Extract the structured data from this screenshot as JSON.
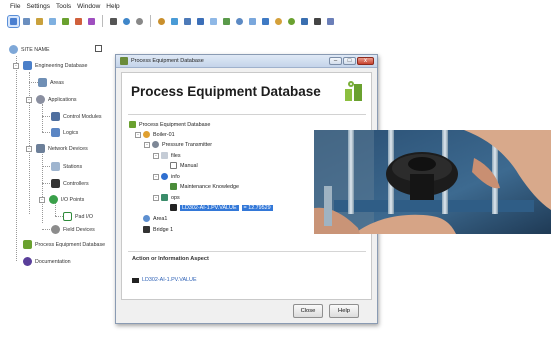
{
  "menu": [
    "File",
    "Settings",
    "Tools",
    "Window",
    "Help"
  ],
  "toolbar_icons": [
    "pointer-icon",
    "gear-icon",
    "wrench-icon",
    "document-icon",
    "refresh-icon",
    "palette-icon",
    "grid-icon",
    "disk-icon",
    "globe-icon",
    "pin-icon",
    "search-icon",
    "chart-icon",
    "monitor-icon",
    "arrow-icon",
    "window-icon",
    "tool-icon",
    "zoom-icon",
    "image-icon",
    "report-icon",
    "cloud-icon",
    "eye-icon",
    "network-icon",
    "list-icon",
    "settings-icon"
  ],
  "tree": {
    "root": "SITE NAME",
    "items": [
      {
        "label": "Engineering Database"
      },
      {
        "label": "Areas"
      },
      {
        "label": "Applications"
      },
      {
        "label": "Control Modules"
      },
      {
        "label": "Logics"
      },
      {
        "label": "Network Devices"
      },
      {
        "label": "Stations"
      },
      {
        "label": "Controllers"
      },
      {
        "label": "I/O Points"
      },
      {
        "label": "Pad I/O"
      },
      {
        "label": "Field Devices"
      },
      {
        "label": "Process Equipment Database"
      },
      {
        "label": "Documentation"
      }
    ]
  },
  "window": {
    "title": "Process Equipment Database",
    "heading": "Process Equipment Database",
    "controls": [
      "–",
      "□",
      "x"
    ],
    "nodes": [
      {
        "label": "Process Equipment Database"
      },
      {
        "label": "Boiler-01"
      },
      {
        "label": "Pressure Transmitter"
      },
      {
        "label": "files"
      },
      {
        "label": "Manual"
      },
      {
        "label": "info"
      },
      {
        "label": "Maintenance Knowledge"
      },
      {
        "label": "ops"
      },
      {
        "label": "LD302-AI-1.PV.VALUE",
        "value": "= 12.79529"
      },
      {
        "label": "Area1"
      },
      {
        "label": "Bridge 1"
      }
    ],
    "aspect_heading": "Action or Information Aspect",
    "aspect_link": "LD302-AI-1.PV.VALUE",
    "close_label": "Close",
    "help_label": "Help"
  },
  "colors": {
    "selection": "#3378d8",
    "link": "#2b5fb5",
    "accent_green": "#6aa12f"
  }
}
